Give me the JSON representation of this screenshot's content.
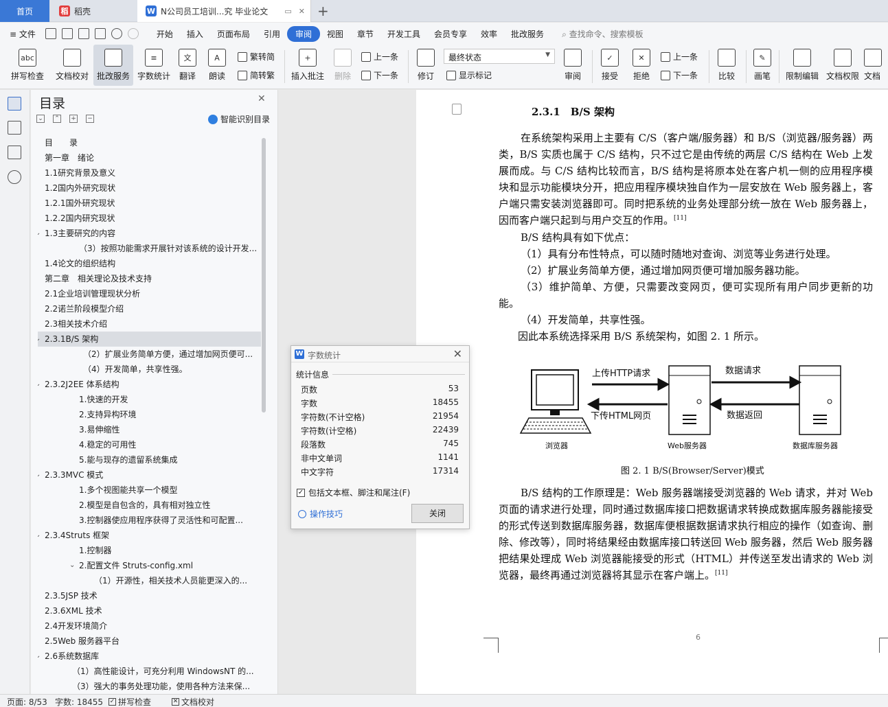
{
  "tabs": [
    {
      "label": "首页"
    },
    {
      "label": "稻壳"
    },
    {
      "label": "N公司员工培训...究 毕业论文"
    }
  ],
  "menu": {
    "file": "文件",
    "items": [
      "开始",
      "插入",
      "页面布局",
      "引用",
      "审阅",
      "视图",
      "章节",
      "开发工具",
      "会员专享",
      "效率",
      "批改服务"
    ],
    "active": "审阅",
    "search_placeholder": "查找命令、搜索模板"
  },
  "ribbon": {
    "spell_check": "拼写检查",
    "doc_proof": "文档校对",
    "review_service": "批改服务",
    "word_count": "字数统计",
    "translate": "翻译",
    "read_aloud": "朗读",
    "trad_to_simp": "繁转简",
    "simp_to_trad": "简转繁",
    "insert_comment": "插入批注",
    "delete": "删除",
    "prev1": "上一条",
    "next1": "下一条",
    "track": "修订",
    "final_state": "最终状态",
    "show_marks": "显示标记",
    "review_pane": "审阅",
    "accept": "接受",
    "reject": "拒绝",
    "prev2": "上一条",
    "next2": "下一条",
    "compare": "比较",
    "pen": "画笔",
    "restrict_edit": "限制编辑",
    "doc_perm": "文档权限",
    "doc_cut": "文档"
  },
  "toc": {
    "title": "目录",
    "smart_label": "智能识别目录",
    "items": [
      {
        "text": "目　　录",
        "lvl": 0
      },
      {
        "text": "第一章　绪论",
        "lvl": 0
      },
      {
        "text": "1.1研究背景及意义",
        "lvl": 0
      },
      {
        "text": "1.2国内外研究现状",
        "lvl": 0
      },
      {
        "text": "1.2.1国外研究现状",
        "lvl": 0
      },
      {
        "text": "1.2.2国内研究现状",
        "lvl": 0
      },
      {
        "text": "1.3主要研究的内容",
        "lvl": 0,
        "chev": true
      },
      {
        "text": "（3）按照功能需求开展针对该系统的设计开发...",
        "lvl": 2
      },
      {
        "text": "1.4论文的组织结构",
        "lvl": 0
      },
      {
        "text": "第二章　相关理论及技术支持",
        "lvl": 0
      },
      {
        "text": "2.1企业培训管理现状分析",
        "lvl": 0
      },
      {
        "text": "2.2诺兰阶段模型介绍",
        "lvl": 0
      },
      {
        "text": "2.3相关技术介绍",
        "lvl": 0
      },
      {
        "text": "2.3.1B/S 架构",
        "lvl": 0,
        "chev": true,
        "sel": true
      },
      {
        "text": "（2）扩展业务简单方便，通过增加网页便可...",
        "lvl": 3
      },
      {
        "text": "（4）开发简单，共享性强。",
        "lvl": 3
      },
      {
        "text": "2.3.2J2EE 体系结构",
        "lvl": 0,
        "chev": true
      },
      {
        "text": "1.快速的开发",
        "lvl": 2
      },
      {
        "text": "2.支持异构环境",
        "lvl": 2
      },
      {
        "text": "3.易伸缩性",
        "lvl": 2
      },
      {
        "text": "4.稳定的可用性",
        "lvl": 2
      },
      {
        "text": "5.能与现存的遗留系统集成",
        "lvl": 2
      },
      {
        "text": "2.3.3MVC 模式",
        "lvl": 0,
        "chev": true
      },
      {
        "text": "1.多个视图能共享一个模型",
        "lvl": 2
      },
      {
        "text": "2.模型是自包含的，具有相对独立性",
        "lvl": 2
      },
      {
        "text": "3.控制器使应用程序获得了灵活性和可配置...",
        "lvl": 2
      },
      {
        "text": "2.3.4Struts 框架",
        "lvl": 0,
        "chev": true
      },
      {
        "text": "1.控制器",
        "lvl": 2
      },
      {
        "text": "2.配置文件 Struts-config.xml",
        "lvl": 2,
        "chev": true
      },
      {
        "text": "（1）开源性，相关技术人员能更深入的...",
        "lvl": 4
      },
      {
        "text": "2.3.5JSP 技术",
        "lvl": 0
      },
      {
        "text": "2.3.6XML 技术",
        "lvl": 0
      },
      {
        "text": "2.4开发环境简介",
        "lvl": 0
      },
      {
        "text": "2.5Web 服务器平台",
        "lvl": 0
      },
      {
        "text": "2.6系统数据库",
        "lvl": 0,
        "chev": true
      },
      {
        "text": "（1）高性能设计，可充分利用 WindowsNT 的...",
        "lvl": 1
      },
      {
        "text": "（3）强大的事务处理功能，使用各种方法来保...",
        "lvl": 1
      }
    ]
  },
  "doc": {
    "section_title": "2.3.1　B/S 架构",
    "para1": "在系统架构采用上主要有 C/S（客户端/服务器）和 B/S（浏览器/服务器）两类，B/S 实质也属于 C/S 结构，只不过它是由传统的两层 C/S 结构在 Web 上发展而成。与 C/S 结构比较而言，B/S 结构是将原本处在客户机一侧的应用程序模块和显示功能模块分开，把应用程序模块独自作为一层安放在 Web 服务器上，客户端只需安装浏览器即可。同时把系统的业务处理部分统一放在 Web 服务器上，因而客户端只起到与用户交互的作用。",
    "cite1": "[11]",
    "para2": "B/S 结构具有如下优点：",
    "li1": "（1）具有分布性特点，可以随时随地对查询、浏览等业务进行处理。",
    "li2": "（2）扩展业务简单方便，通过增加网页便可增加服务器功能。",
    "li3": "（3）维护简单、方便，只需要改变网页，便可实现所有用户同步更新的功能。",
    "li4": "（4）开发简单，共享性强。",
    "para3": "因此本系统选择采用 B/S 系统架构，如图 2. 1 所示。",
    "diagram": {
      "upload": "上传HTTP请求",
      "download": "下传HTML网页",
      "data_req": "数据请求",
      "data_ret": "数据返回",
      "browser": "浏览器",
      "web_server": "Web服务器",
      "db_server": "数据库服务器"
    },
    "fig_caption": "图 2. 1 B/S(Browser/Server)模式",
    "para4": "B/S 结构的工作原理是：Web 服务器端接受浏览器的 Web 请求，并对 Web 页面的请求进行处理，同时通过数据库接口把数据请求转换成数据库服务器能接受的形式传送到数据库服务器，数据库便根据数据请求执行相应的操作（如查询、删除、修改等），同时将结果经由数据库接口转送回 Web 服务器，然后 Web 服务器把结果处理成 Web 浏览器能接受的形式（HTML）并传送至发出请求的 Web 浏览器，最终再通过浏览器将其显示在客户端上。",
    "cite2": "[11]",
    "page_number": "6"
  },
  "word_count": {
    "title": "字数统计",
    "stats_label": "统计信息",
    "rows": [
      {
        "label": "页数",
        "value": "53"
      },
      {
        "label": "字数",
        "value": "18455"
      },
      {
        "label": "字符数(不计空格)",
        "value": "21954"
      },
      {
        "label": "字符数(计空格)",
        "value": "22439"
      },
      {
        "label": "段落数",
        "value": "745"
      },
      {
        "label": "非中文单词",
        "value": "1141"
      },
      {
        "label": "中文字符",
        "value": "17314"
      }
    ],
    "include_label": "包括文本框、脚注和尾注(F)",
    "include_checked": "✓",
    "tips": "操作技巧",
    "close": "关闭"
  },
  "status": {
    "page": "页面: 8/53",
    "words": "字数: 18455",
    "spell": "拼写检查",
    "proof": "文档校对"
  },
  "colors": {
    "accent": "#2f6fd6",
    "docer": "#e23d3d"
  }
}
